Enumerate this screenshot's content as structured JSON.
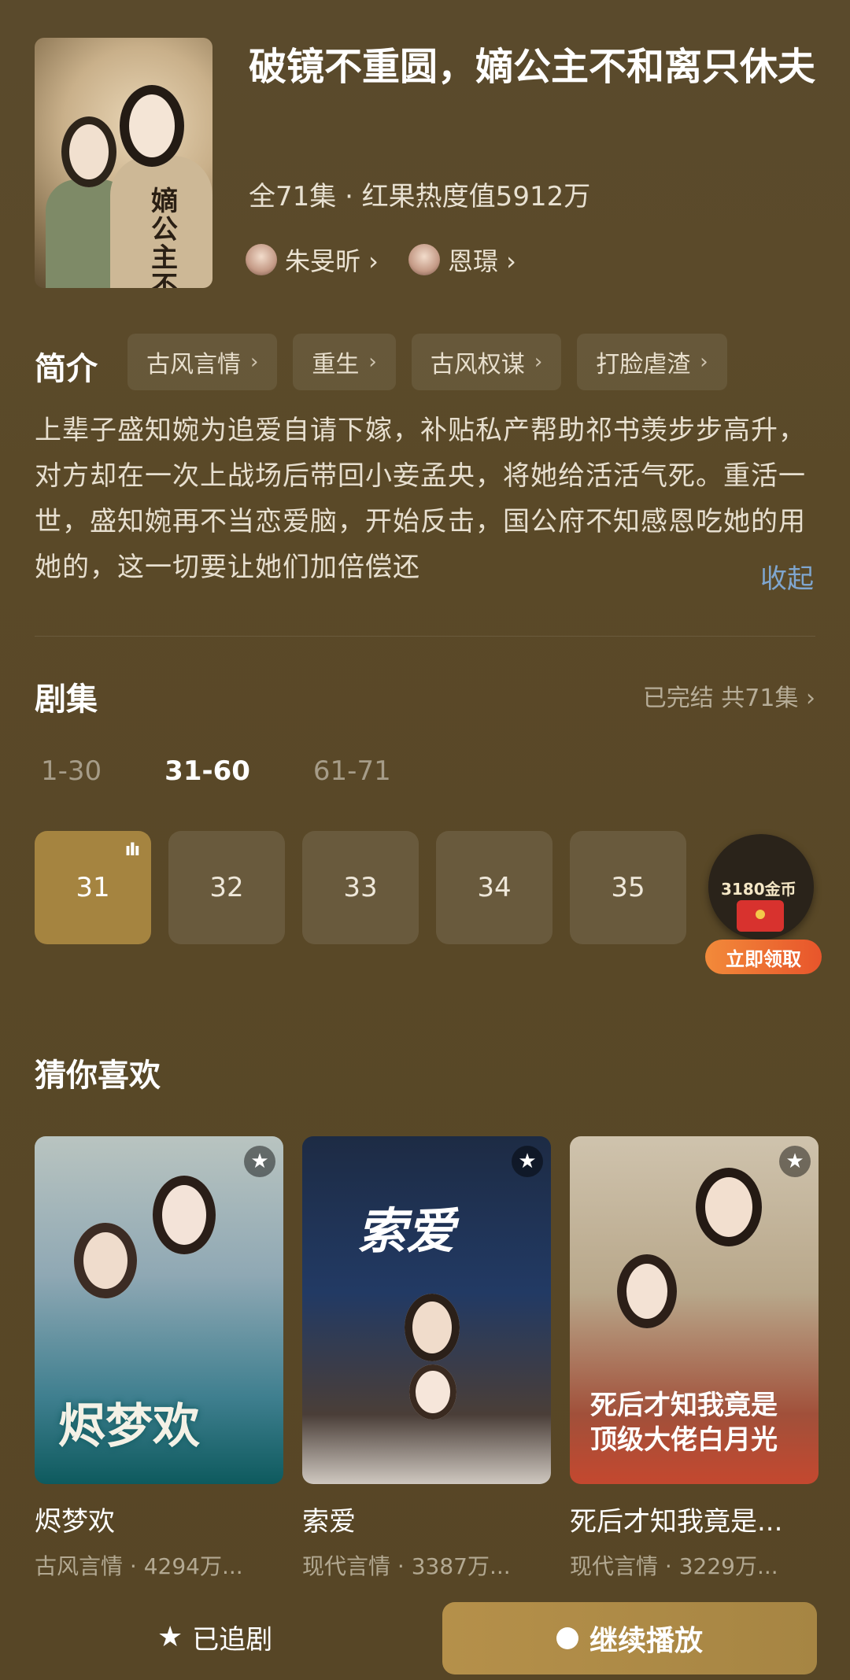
{
  "drama": {
    "title": "破镜不重圆，嫡公主不和离只休夫",
    "meta": "全71集 · 红果热度值5912万",
    "poster_text": "嫡公主不和离",
    "actors": [
      {
        "name": "朱旻昕 ›"
      },
      {
        "name": "恩璟 ›"
      }
    ]
  },
  "intro": {
    "label": "简介",
    "tags": [
      "古风言情",
      "重生",
      "古风权谋",
      "打脸虐渣"
    ],
    "tag_chevron": "›",
    "synopsis": "上辈子盛知婉为追爱自请下嫁，补贴私产帮助祁书羡步步高升，对方却在一次上战场后带回小妾孟央，将她给活活气死。重活一世，盛知婉再不当恋爱脑，开始反击，国公府不知感恩吃她的用她的，这一切要让她们加倍偿还",
    "collapse": "收起"
  },
  "episodes": {
    "label": "剧集",
    "status": "已完结 共71集 ›",
    "ranges": [
      "1-30",
      "31-60",
      "61-71"
    ],
    "active_range": 1,
    "items": [
      "31",
      "32",
      "33",
      "34",
      "35"
    ],
    "active_item": 0,
    "playing_glyph": "ıIı"
  },
  "promo": {
    "coins": "3180金币",
    "claim": "立即领取"
  },
  "recommend": {
    "label": "猜你喜欢",
    "items": [
      {
        "title": "烬梦欢",
        "sub": "古风言情 · 4294万...",
        "cover_text": "烬梦欢"
      },
      {
        "title": "索爱",
        "sub": "现代言情 · 3387万...",
        "cover_text": "索爱"
      },
      {
        "title": "死后才知我竟是...",
        "sub": "现代言情 · 3229万...",
        "cover_text": "死后才知我竟是顶级大佬白月光"
      }
    ]
  },
  "bottom": {
    "follow": "已追剧",
    "play": "继续播放"
  },
  "colors": {
    "accent": "#a58440",
    "link": "#7fa6cf",
    "claim": "#e8552b"
  }
}
